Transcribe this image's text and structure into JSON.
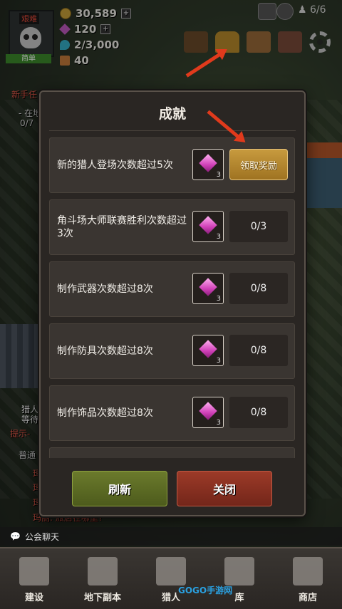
{
  "hud": {
    "rank_top": "艰难",
    "rank_bottom": "简单",
    "gold": "30,589",
    "gems": "120",
    "souls": "2/3,000",
    "food": "40",
    "hunters": "6/6"
  },
  "side": {
    "quest_title": "新手任",
    "quest_line1": "- 在地",
    "quest_line2": "0/7",
    "notice1": "猎人",
    "notice2": "等待",
    "hint": "提示-",
    "tab": "普通",
    "chat_line1": "玛",
    "chat_line2": "玛",
    "chat_line3": "玛",
    "chat_line4": "玛丽: 旅店在哪里?"
  },
  "modal": {
    "title": "成就",
    "achievements": [
      {
        "label": "新的猎人登场次数超过5次",
        "reward_qty": "3",
        "status": "领取奖励",
        "claimable": true
      },
      {
        "label": "角斗场大师联赛胜利次数超过3次",
        "reward_qty": "3",
        "status": "0/3",
        "claimable": false
      },
      {
        "label": "制作武器次数超过8次",
        "reward_qty": "3",
        "status": "0/8",
        "claimable": false
      },
      {
        "label": "制作防具次数超过8次",
        "reward_qty": "3",
        "status": "0/8",
        "claimable": false
      },
      {
        "label": "制作饰品次数超过8次",
        "reward_qty": "3",
        "status": "0/8",
        "claimable": false
      }
    ],
    "refresh_label": "刷新",
    "close_label": "关闭"
  },
  "chat": {
    "label": "公会聊天"
  },
  "nav": [
    {
      "label": "建设",
      "icon": "hammer-icon"
    },
    {
      "label": "地下副本",
      "icon": "dungeon-gate-icon"
    },
    {
      "label": "猎人",
      "icon": "hunter-icon"
    },
    {
      "label": "库",
      "icon": "warehouse-icon"
    },
    {
      "label": "商店",
      "icon": "shop-icon"
    }
  ],
  "watermark": "GOGO手游网",
  "colors": {
    "claim": "#c79a3e",
    "refresh": "#6b7a2c",
    "close": "#9c3a28",
    "arrow": "#e03a1c"
  }
}
